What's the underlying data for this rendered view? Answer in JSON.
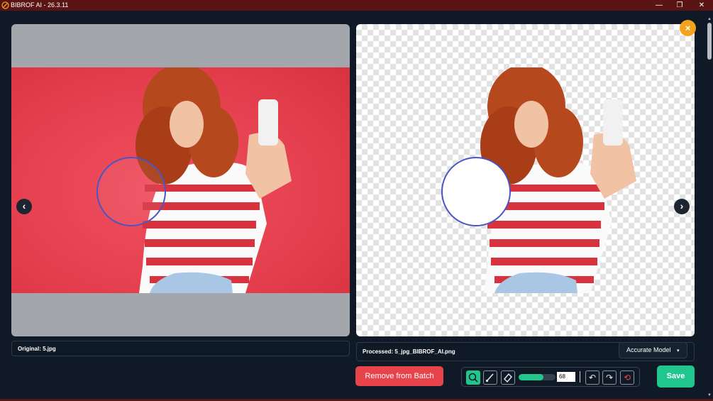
{
  "window": {
    "title": "BIBROF AI - 26.3.11",
    "minimize": "—",
    "restore": "❐",
    "close": "✕"
  },
  "viewer": {
    "prev": "‹",
    "next": "›",
    "close_badge": "×",
    "original_caption": "Original: 5.jpg",
    "processed_caption": "Processed: 5_jpg_BIBROF_AI.png"
  },
  "model_select": {
    "value": "Accurate Model",
    "arrow": "▾"
  },
  "actions": {
    "remove_label": "Remove from Batch",
    "save_label": "Save"
  },
  "toolbar": {
    "tools": [
      "zoom-icon",
      "brush-icon",
      "eraser-icon"
    ],
    "brush_size": "68",
    "brush_level": 0.68,
    "undo": "↶",
    "redo": "↷",
    "reset": "⟲"
  },
  "colors": {
    "accent": "#22c58a",
    "danger": "#e8434b",
    "warning": "#f5a21c",
    "background": "#0f1a26",
    "titlebar": "#5a1414"
  }
}
